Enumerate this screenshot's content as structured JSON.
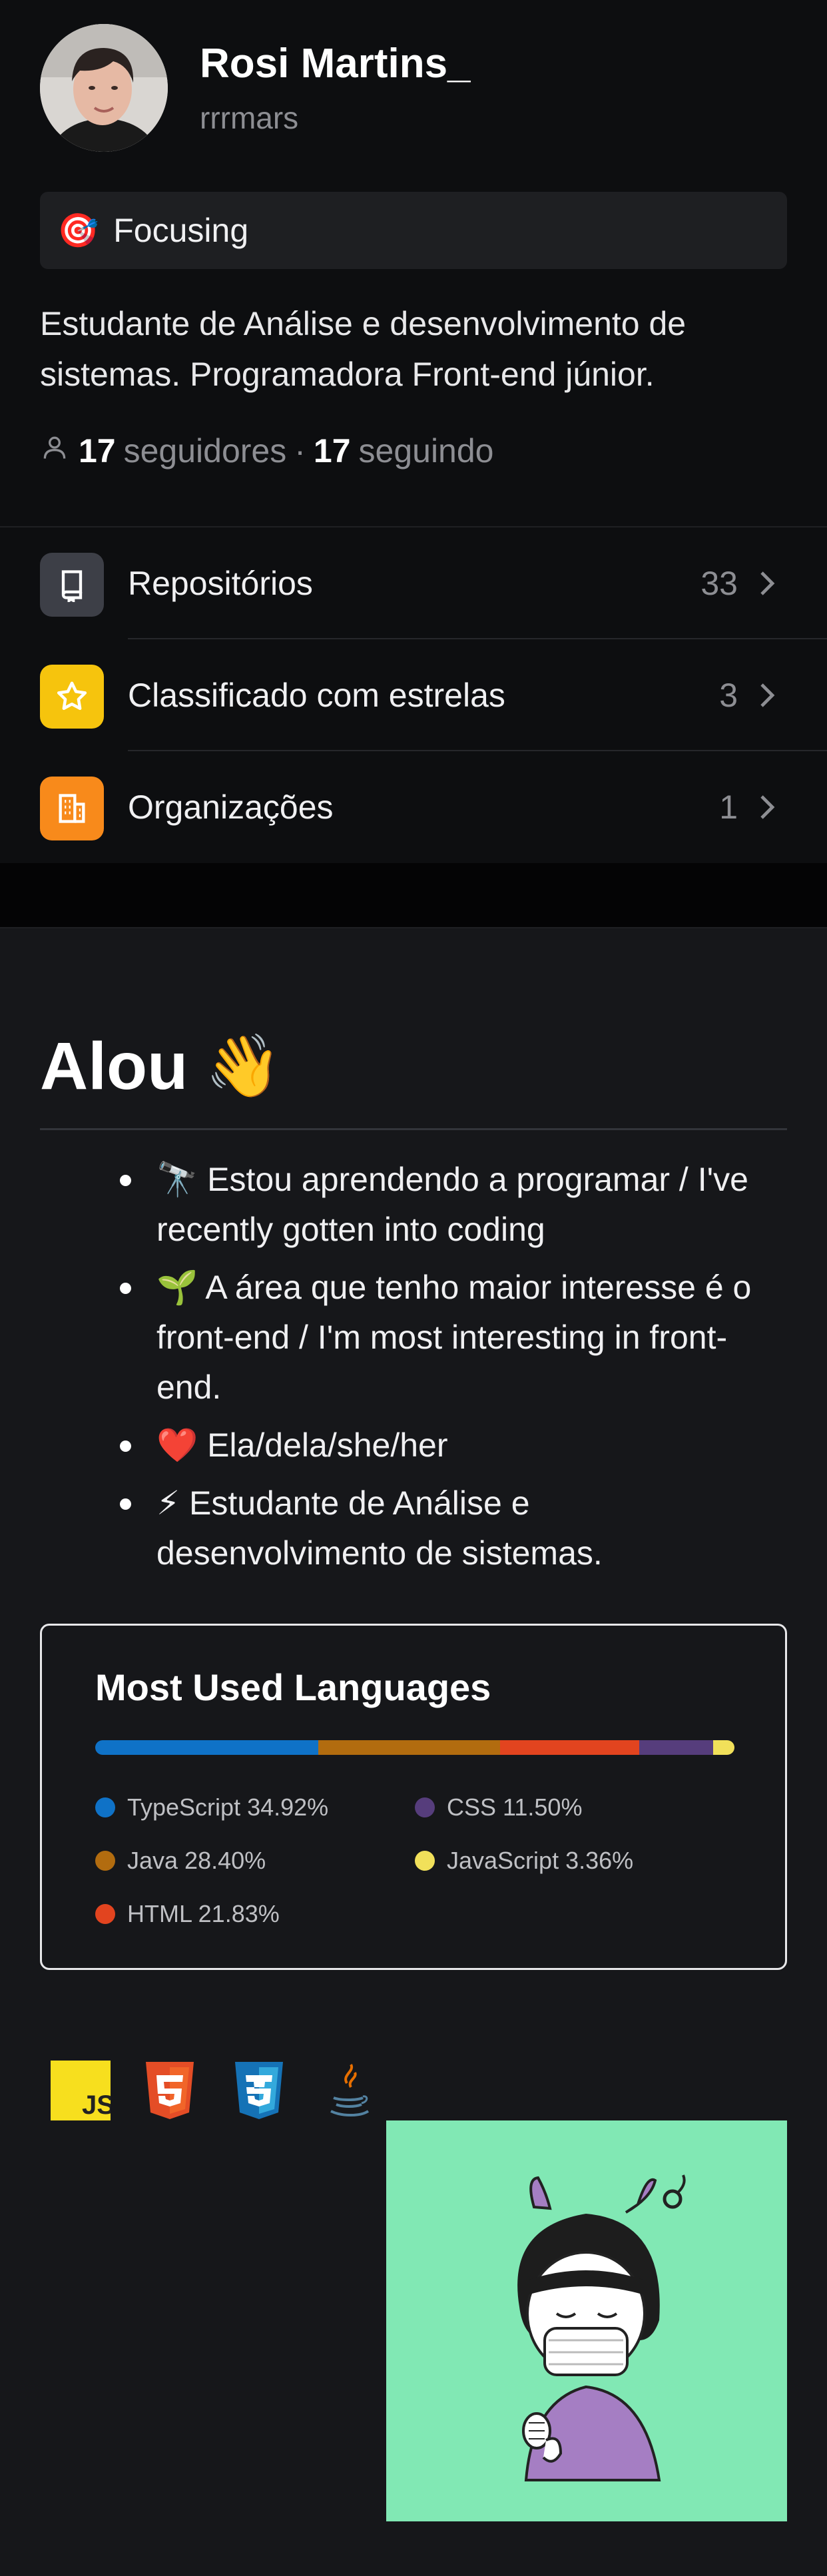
{
  "profile": {
    "name": "Rosi Martins_",
    "login": "rrrmars",
    "status_emoji": "🎯",
    "status_text": "Focusing",
    "bio": "Estudante de Análise e desenvolvimento de sistemas. Programadora Front-end júnior.",
    "followers_count": "17",
    "followers_label": "seguidores",
    "separator": "·",
    "following_count": "17",
    "following_label": "seguindo"
  },
  "menu": [
    {
      "label": "Repositórios",
      "count": "33",
      "icon": "repo-icon",
      "color": "#3d3f47"
    },
    {
      "label": "Classificado com estrelas",
      "count": "3",
      "icon": "star-icon",
      "color": "#f6c40d"
    },
    {
      "label": "Organizações",
      "count": "1",
      "icon": "organization-icon",
      "color": "#f88a1b"
    }
  ],
  "readme": {
    "heading": "Alou",
    "heading_emoji": "👋",
    "bullets": [
      "🔭 Estou aprendendo a programar / I've recently gotten into coding",
      "🌱 A área que tenho maior interesse é o front-end / I'm most interesting in front-end.",
      "❤️ Ela/dela/she/her",
      "⚡ Estudante de Análise e desenvolvimento de sistemas."
    ],
    "tech_icons": [
      "javascript-icon",
      "html5-icon",
      "css3-icon",
      "java-icon"
    ]
  },
  "languages_card": {
    "title": "Most Used Languages",
    "languages": [
      {
        "name": "TypeScript",
        "percent": 34.92,
        "label": "TypeScript 34.92%",
        "color": "#0f72c7"
      },
      {
        "name": "Java",
        "percent": 28.4,
        "label": "Java 28.40%",
        "color": "#b26c0f"
      },
      {
        "name": "HTML",
        "percent": 21.83,
        "label": "HTML 21.83%",
        "color": "#e2441f"
      },
      {
        "name": "CSS",
        "percent": 11.5,
        "label": "CSS 11.50%",
        "color": "#563d7c"
      },
      {
        "name": "JavaScript",
        "percent": 3.36,
        "label": "JavaScript 3.36%",
        "color": "#f1e05a"
      }
    ]
  },
  "colors": {
    "background": "#0d0e10",
    "readme_background": "#16171a",
    "illustration_background": "#81e8b4"
  }
}
